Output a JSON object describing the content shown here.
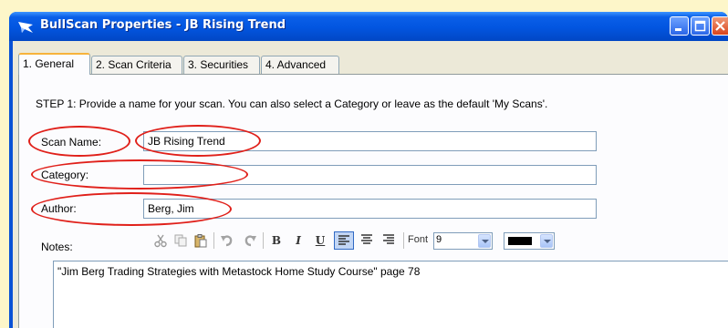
{
  "window": {
    "title": "BullScan Properties - JB Rising Trend"
  },
  "tabs": [
    {
      "label": "1. General"
    },
    {
      "label": "2. Scan Criteria"
    },
    {
      "label": "3. Securities"
    },
    {
      "label": "4. Advanced"
    }
  ],
  "general": {
    "step_text": "STEP 1: Provide a name for your scan. You can also select a Category or leave as the default 'My Scans'.",
    "scan_name_label": "Scan Name:",
    "scan_name_value": "JB Rising Trend",
    "category_label": "Category:",
    "category_value": "",
    "author_label": "Author:",
    "author_value": "Berg, Jim",
    "notes_label": "Notes:",
    "notes_value": "\"Jim Berg Trading Strategies with Metastock Home Study Course\" page 78"
  },
  "toolbar": {
    "bold": "B",
    "italic": "I",
    "underline": "U",
    "font_label": "Font",
    "font_size": "9",
    "font_color": "#000000"
  },
  "annotations": {
    "circle_color": "#e0201a"
  }
}
